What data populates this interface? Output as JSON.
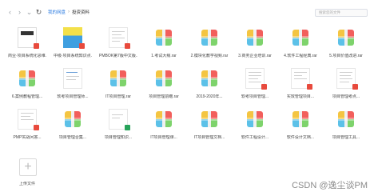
{
  "toolbar": {
    "back_icon": "chevron-left-icon",
    "forward_icon": "chevron-right-icon",
    "dropdown_icon": "chevron-down-icon",
    "refresh_icon": "refresh-icon"
  },
  "breadcrumb": {
    "root": "我的网盘",
    "current": "投资资料"
  },
  "search": {
    "placeholder": "搜索您的文件"
  },
  "files": {
    "r1": [
      {
        "label": "商业·项目系统化思维..."
      },
      {
        "label": "中级·项目系统知识点..."
      },
      {
        "label": "PMBOK第7版中文版..."
      },
      {
        "label": "1.考试大纲.rar"
      },
      {
        "label": "2.模块化教学视频.rar"
      },
      {
        "label": "3.商务企业培训.rar"
      },
      {
        "label": "4.软件工程经典.rar"
      },
      {
        "label": "5.项目价值改进.rar"
      }
    ],
    "r2": [
      {
        "label": "6.案例教程管理..."
      },
      {
        "label": "软考项目管理师..."
      },
      {
        "label": "IT项目管理.rar"
      },
      {
        "label": "项目管理前瞻.rar"
      },
      {
        "label": "2019-2020年..."
      },
      {
        "label": "软考项目管理..."
      },
      {
        "label": "实效管理项目..."
      },
      {
        "label": "项目管理考点..."
      }
    ],
    "r3": [
      {
        "label": "PMP实战问答..."
      },
      {
        "label": "项目管理合集..."
      },
      {
        "label": "项目管理知识..."
      },
      {
        "label": "IT项目管理课..."
      },
      {
        "label": "IT项目管理文档..."
      },
      {
        "label": "软件工程设计..."
      },
      {
        "label": "软件设计文档..."
      },
      {
        "label": "项目管理工具..."
      }
    ]
  },
  "upload": {
    "label": "上传文件"
  },
  "watermark": "CSDN @逸尘谈PM"
}
